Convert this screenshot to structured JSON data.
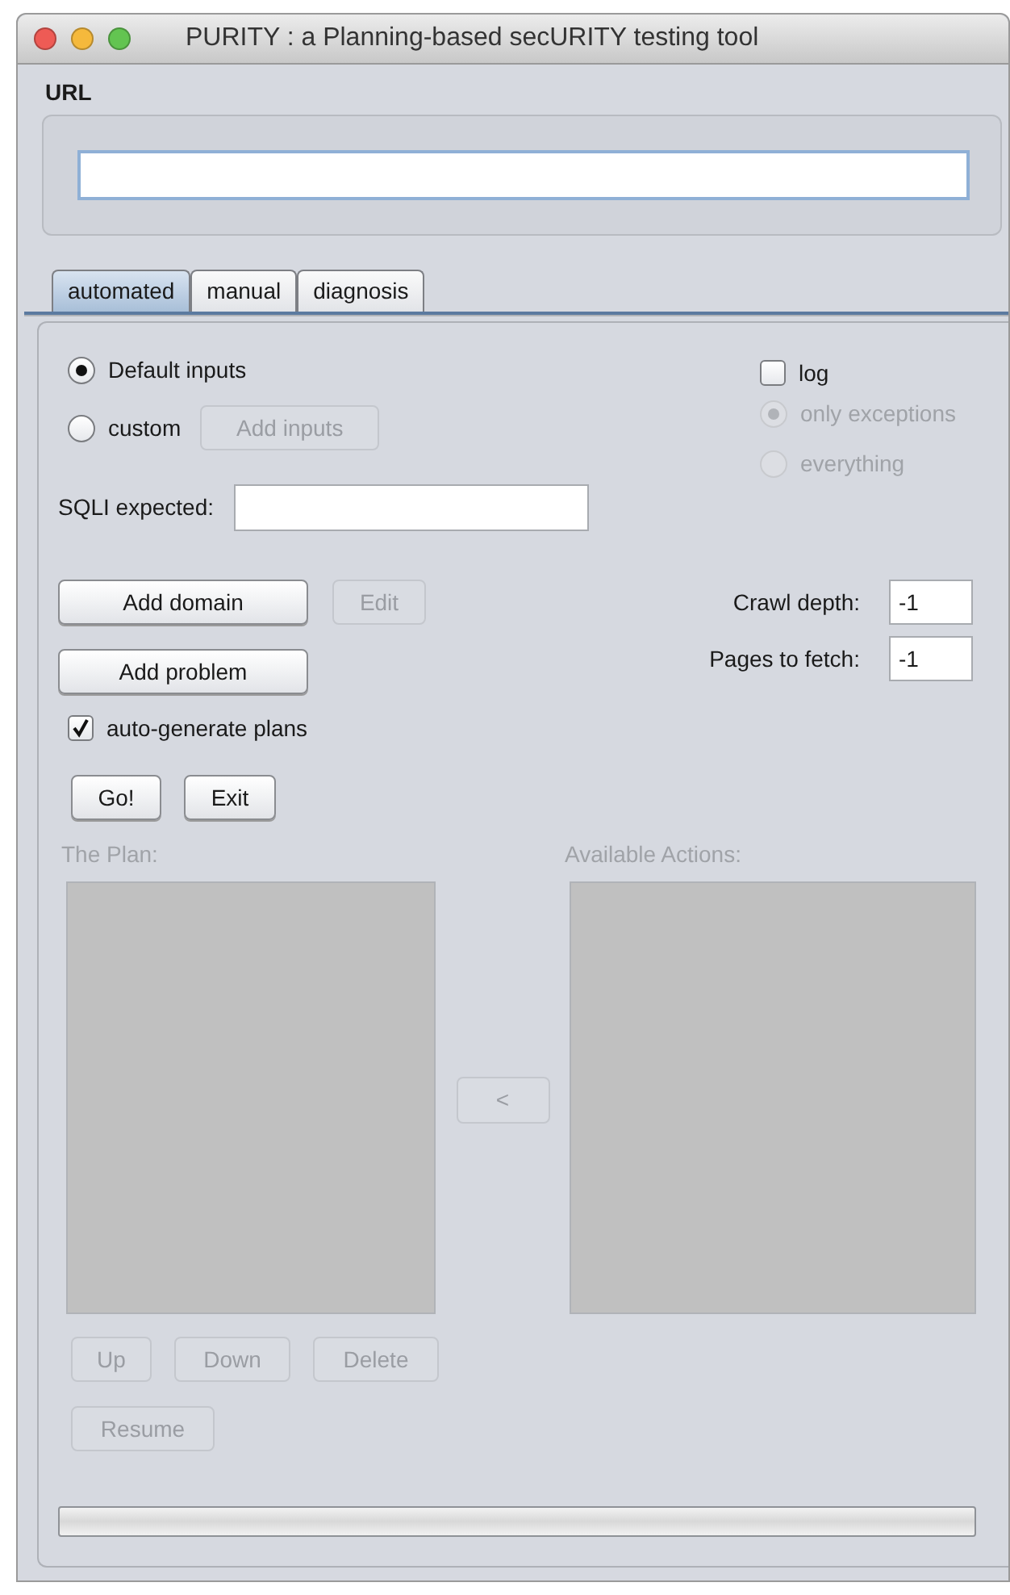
{
  "window": {
    "title": "PURITY : a Planning-based secURITY testing tool"
  },
  "url": {
    "label": "URL"
  },
  "tabs": [
    {
      "label": "automated",
      "selected": true
    },
    {
      "label": "manual",
      "selected": false
    },
    {
      "label": "diagnosis",
      "selected": false
    }
  ],
  "input_mode": [
    {
      "label": "Default inputs",
      "selected": true
    },
    {
      "label": "custom",
      "selected": false
    }
  ],
  "add_inputs_button": {
    "label": "Add inputs",
    "disabled": true
  },
  "log": {
    "label": "log",
    "checked": false
  },
  "log_level": [
    {
      "label": "only exceptions",
      "selected": true,
      "disabled": true
    },
    {
      "label": "everything",
      "selected": false,
      "disabled": true
    }
  ],
  "sqli_expected": {
    "label": "SQLI expected:"
  },
  "add_domain_button": {
    "label": "Add domain",
    "disabled": false
  },
  "edit_button": {
    "label": "Edit",
    "disabled": true
  },
  "add_problem_button": {
    "label": "Add problem",
    "disabled": false
  },
  "crawl_depth": {
    "label": "Crawl depth:",
    "value": "-1"
  },
  "pages_to_fetch": {
    "label": "Pages to fetch:",
    "value": "-1"
  },
  "auto_generate": {
    "label": "auto-generate plans",
    "checked": true
  },
  "go_button": {
    "label": "Go!",
    "disabled": false
  },
  "exit_button": {
    "label": "Exit",
    "disabled": false
  },
  "plan": {
    "label": "The Plan:",
    "disabled": true
  },
  "available_actions": {
    "label": "Available Actions:",
    "disabled": true
  },
  "move_button": {
    "label": "<",
    "disabled": true
  },
  "plan_buttons": [
    {
      "label": "Up",
      "disabled": true
    },
    {
      "label": "Down",
      "disabled": true
    },
    {
      "label": "Delete",
      "disabled": true
    }
  ],
  "resume_button": {
    "label": "Resume",
    "disabled": true
  },
  "progress": {
    "level": 0
  }
}
